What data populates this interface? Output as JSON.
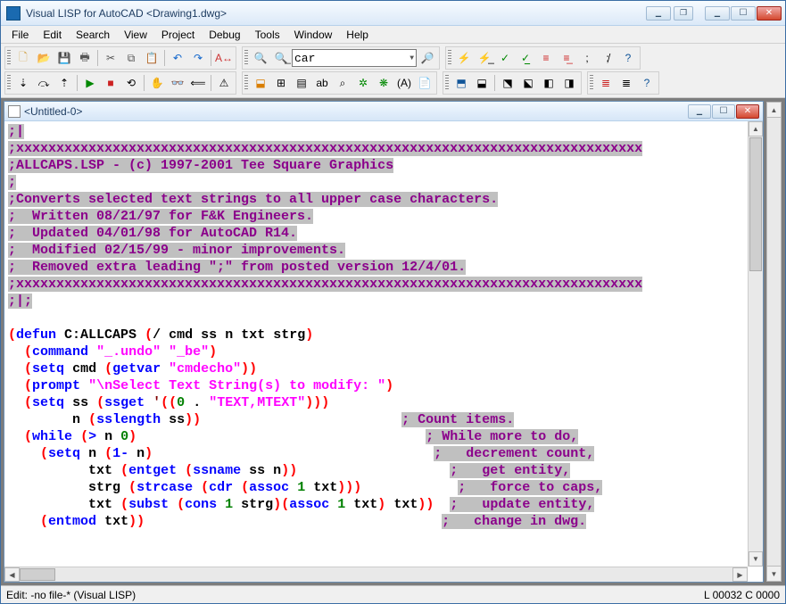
{
  "window": {
    "title": "Visual LISP for AutoCAD <Drawing1.dwg>"
  },
  "menubar": {
    "items": [
      "File",
      "Edit",
      "Search",
      "View",
      "Project",
      "Debug",
      "Tools",
      "Window",
      "Help"
    ]
  },
  "toolbar": {
    "combo_value": "car"
  },
  "inner_window": {
    "title": "<Untitled-0>"
  },
  "code": {
    "l1": ";|",
    "l2": ";xxxxxxxxxxxxxxxxxxxxxxxxxxxxxxxxxxxxxxxxxxxxxxxxxxxxxxxxxxxxxxxxxxxxxxxxxxxxxx",
    "l3": ";ALLCAPS.LSP - (c) 1997-2001 Tee Square Graphics",
    "l4": ";",
    "l5": ";Converts selected text strings to all upper case characters.",
    "l6": ";  Written 08/21/97 for F&K Engineers.",
    "l7": ";  Updated 04/01/98 for AutoCAD R14.",
    "l8": ";  Modified 02/15/99 - minor improvements.",
    "l9": ";  Removed extra leading \";\" from posted version 12/4/01.",
    "l10": ";xxxxxxxxxxxxxxxxxxxxxxxxxxxxxxxxxxxxxxxxxxxxxxxxxxxxxxxxxxxxxxxxxxxxxxxxxxxxxx",
    "l11": ";|;",
    "c1": "; Count items.",
    "c2": "; While more to do,",
    "c3": ";   decrement count,",
    "c4": ";   get entity,",
    "c5": ";   force to caps,",
    "c6": ";   update entity,",
    "c7": ";   change in dwg.",
    "defun": "defun",
    "command": "command",
    "setq": "setq",
    "getvar": "getvar",
    "prompt": "prompt",
    "ssget": "ssget",
    "sslength": "sslength",
    "while": "while",
    "entget": "entget",
    "ssname": "ssname",
    "strcase": "strcase",
    "cdr": "cdr",
    "assoc": "assoc",
    "subst": "subst",
    "cons": "cons",
    "entmod": "entmod",
    "sym_allcaps": "C:ALLCAPS",
    "sym_slash": "/",
    "sym_cmd": "cmd",
    "sym_ss": "ss",
    "sym_n": "n",
    "sym_txt": "txt",
    "sym_strg": "strg",
    "str_undo": "\"_.undo\"",
    "str_be": "\"_be\"",
    "str_cmdecho": "\"cmdecho\"",
    "str_prompt": "\"\\nSelect Text String(s) to modify: \"",
    "str_text": "\"TEXT,MTEXT\"",
    "num_0": "0",
    "num_1": "1",
    "num_1b": "1-",
    "op_gt": ">"
  },
  "statusbar": {
    "left": "Edit: -no file-*  (Visual LISP)",
    "right": "L 00032  C 0000"
  }
}
